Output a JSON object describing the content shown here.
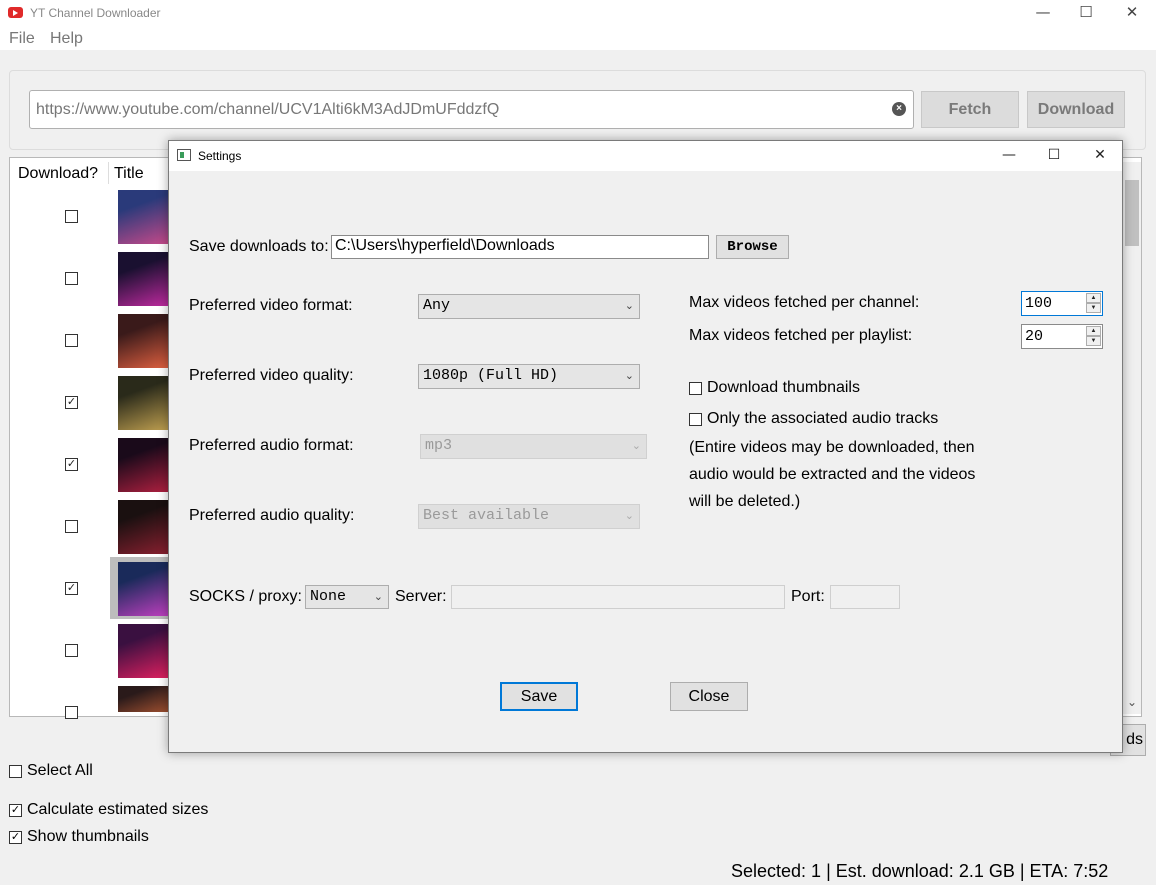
{
  "window": {
    "title": "YT Channel Downloader",
    "minimize": "—",
    "maximize": "☐",
    "close": "✕"
  },
  "menu": [
    "File",
    "Help"
  ],
  "url_bar": {
    "value": "https://www.youtube.com/channel/UCV1Alti6kM3AdJDmUFddzfQ",
    "clear_icon": "clear-circle-icon"
  },
  "buttons": {
    "fetch": "Fetch",
    "download": "Download",
    "partial_right": "ds"
  },
  "video_list": {
    "columns": [
      "Download?",
      "Title"
    ],
    "rows": [
      {
        "checked": false,
        "thumb_colors": [
          "#2a3a7a",
          "#c84a8a"
        ]
      },
      {
        "checked": false,
        "thumb_colors": [
          "#1a1030",
          "#c02aa0"
        ]
      },
      {
        "checked": false,
        "thumb_colors": [
          "#3a1a1a",
          "#e06040"
        ]
      },
      {
        "checked": true,
        "thumb_colors": [
          "#2a2a1a",
          "#c0a050"
        ]
      },
      {
        "checked": true,
        "thumb_colors": [
          "#1a0a1a",
          "#b02040"
        ]
      },
      {
        "checked": false,
        "thumb_colors": [
          "#1a1010",
          "#8a2030"
        ]
      },
      {
        "checked": true,
        "thumb_colors": [
          "#1a2a5a",
          "#c040c0"
        ]
      },
      {
        "checked": false,
        "thumb_colors": [
          "#3a1040",
          "#e02060"
        ]
      },
      {
        "checked": false,
        "thumb_colors": [
          "#2a1a1a",
          "#a05030"
        ]
      }
    ]
  },
  "options": {
    "select_all": {
      "label": "Select All",
      "checked": false
    },
    "calc_sizes": {
      "label": "Calculate estimated sizes",
      "checked": true
    },
    "show_thumbs": {
      "label": "Show thumbnails",
      "checked": true
    }
  },
  "status_text": "Selected: 1 | Est. download: 2.1 GB | ETA: 7:52",
  "settings": {
    "title": "Settings",
    "save_to_label": "Save downloads to:",
    "save_to_value": "C:\\Users\\hyperfield\\Downloads",
    "browse": "Browse",
    "video_format_label": "Preferred video format:",
    "video_format_value": "Any",
    "video_quality_label": "Preferred video quality:",
    "video_quality_value": "1080p (Full HD)",
    "audio_format_label": "Preferred audio format:",
    "audio_format_value": "mp3",
    "audio_quality_label": "Preferred audio quality:",
    "audio_quality_value": "Best available",
    "max_channel_label": "Max videos fetched per channel:",
    "max_channel_value": "100",
    "max_playlist_label": "Max videos fetched per playlist:",
    "max_playlist_value": "20",
    "download_thumbs": {
      "label": "Download thumbnails",
      "checked": false
    },
    "audio_only": {
      "label": "Only the associated audio tracks",
      "checked": false
    },
    "note_lines": [
      "(Entire videos may be downloaded, then",
      "audio would be extracted and the videos",
      "will be deleted.)"
    ],
    "proxy_label": "SOCKS / proxy:",
    "proxy_value": "None",
    "server_label": "Server:",
    "server_value": "",
    "port_label": "Port:",
    "port_value": "",
    "save": "Save",
    "close": "Close"
  }
}
